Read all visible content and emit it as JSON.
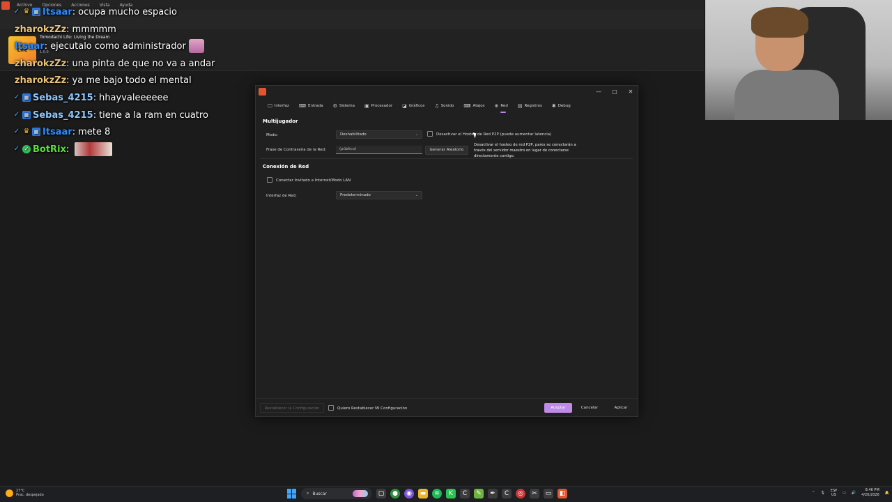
{
  "background_app": {
    "menu": [
      "Archivo",
      "Opciones",
      "Acciones",
      "Vista",
      "Ayuda"
    ],
    "game_title": "Tomodachi Life: Living the Dream",
    "game_cover_text": "Life",
    "game_version": "1.0.0"
  },
  "chat": [
    {
      "badges": [
        "sword",
        "crown",
        "grid"
      ],
      "user": "Itsaar",
      "color": "blue",
      "text": "ocupa mucho espacio",
      "emote": false
    },
    {
      "badges": [],
      "user": "zharokzZz",
      "color": "yellow",
      "text": "mmmmm",
      "emote": false
    },
    {
      "badges": [],
      "user": "Itsaar",
      "color": "blue",
      "text": "ejecutalo como administrador",
      "emote": true
    },
    {
      "badges": [],
      "user": "zharokzZz",
      "color": "yellow",
      "text": "una pinta de que no va a andar",
      "emote": false
    },
    {
      "badges": [],
      "user": "zharokzZz",
      "color": "yellow",
      "text": "ya me bajo todo el mental",
      "emote": false
    },
    {
      "badges": [
        "sword",
        "grid"
      ],
      "user": "Sebas_4215",
      "color": "lightblue",
      "text": "hhayvaleeeeee",
      "emote": false
    },
    {
      "badges": [
        "sword",
        "grid"
      ],
      "user": "Sebas_4215",
      "color": "lightblue",
      "text": "tiene a la ram en cuatro",
      "emote": false
    },
    {
      "badges": [
        "sword",
        "crown",
        "grid"
      ],
      "user": "Itsaar",
      "color": "blue",
      "text": "mete 8",
      "emote": false
    },
    {
      "badges": [
        "sword",
        "check"
      ],
      "user": "BotRix",
      "color": "green",
      "text": "",
      "emote": "wide"
    }
  ],
  "dialog": {
    "tabs": [
      {
        "icon": "🖵",
        "label": "Interfaz"
      },
      {
        "icon": "⌨",
        "label": "Entrada"
      },
      {
        "icon": "⚙",
        "label": "Sistema"
      },
      {
        "icon": "▣",
        "label": "Procesador"
      },
      {
        "icon": "◪",
        "label": "Gráficos"
      },
      {
        "icon": "♫",
        "label": "Sonido"
      },
      {
        "icon": "⌨",
        "label": "Atajos"
      },
      {
        "icon": "⊕",
        "label": "Red"
      },
      {
        "icon": "▤",
        "label": "Registros"
      },
      {
        "icon": "✱",
        "label": "Debug"
      }
    ],
    "active_tab": "Red",
    "multiplayer": {
      "title": "Multijugador",
      "mode_label": "Modo:",
      "mode_value": "Deshabilitado",
      "disable_p2p_label": "Desactivar el Hosteo de Red P2P (puede aumentar latencia)",
      "passphrase_label": "Frase de Contraseña de la Red:",
      "passphrase_placeholder": "(público)",
      "generate_button": "Generar Aleatorio",
      "tooltip": "Desactivar el hosteo de red P2P, pares se conectarán a través del servidor maestro en lugar de conectarse directamente contigo."
    },
    "network": {
      "title": "Conexión de Red",
      "guest_label": "Conectar Invitado a Internet/Modo LAN",
      "interface_label": "Interfaz de Red:",
      "interface_value": "Predeterminado"
    },
    "footer": {
      "reset_button": "Restablecer la Configuración",
      "confirm_reset_label": "Quiero Restablecer Mi Configuración",
      "accept_button": "Aceptar",
      "cancel_button": "Cancelar",
      "apply_button": "Aplicar"
    },
    "accent_color": "#c08ae8"
  },
  "taskbar": {
    "weather_temp": "27°C",
    "weather_desc": "Prac. despejado",
    "search_label": "Buscar",
    "lang_1": "ESP",
    "lang_2": "US",
    "time": "8:46 PM",
    "date": "4/26/2026"
  }
}
